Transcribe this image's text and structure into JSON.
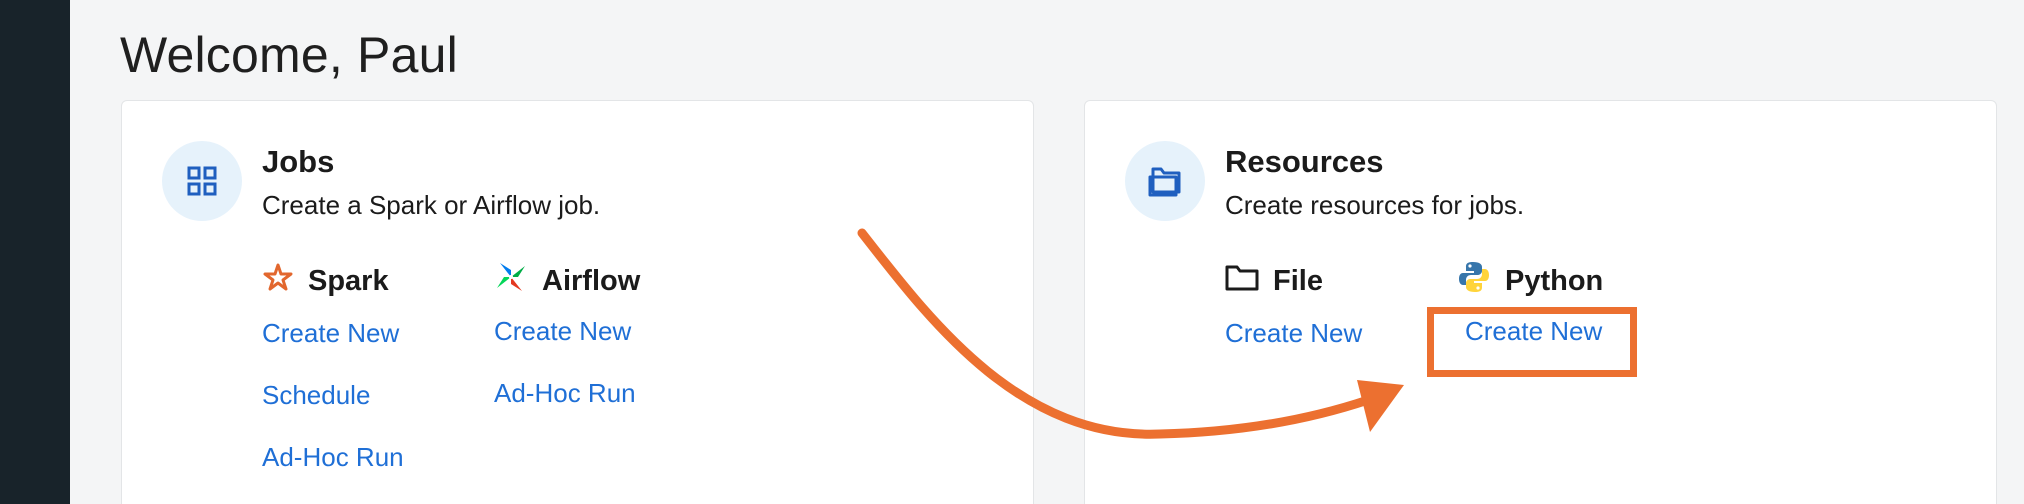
{
  "welcome": "Welcome, Paul",
  "jobs": {
    "title": "Jobs",
    "subtitle": "Create a Spark or Airflow job.",
    "spark": {
      "label": "Spark",
      "links": [
        "Create New",
        "Schedule",
        "Ad-Hoc Run"
      ]
    },
    "airflow": {
      "label": "Airflow",
      "links": [
        "Create New",
        "Ad-Hoc Run"
      ]
    }
  },
  "resources": {
    "title": "Resources",
    "subtitle": "Create resources for jobs.",
    "file": {
      "label": "File",
      "links": [
        "Create New"
      ]
    },
    "python": {
      "label": "Python",
      "links": [
        "Create New"
      ]
    }
  },
  "colors": {
    "sidebar": "#18232a",
    "link": "#1f6fd6",
    "annotation": "#ec7030",
    "icon_circle": "#e6f2fb"
  },
  "icons": {
    "jobs": "grid-icon",
    "resources": "folder-icon",
    "spark": "spark-icon",
    "airflow": "airflow-icon",
    "file": "folder-outline-icon",
    "python": "python-icon"
  }
}
